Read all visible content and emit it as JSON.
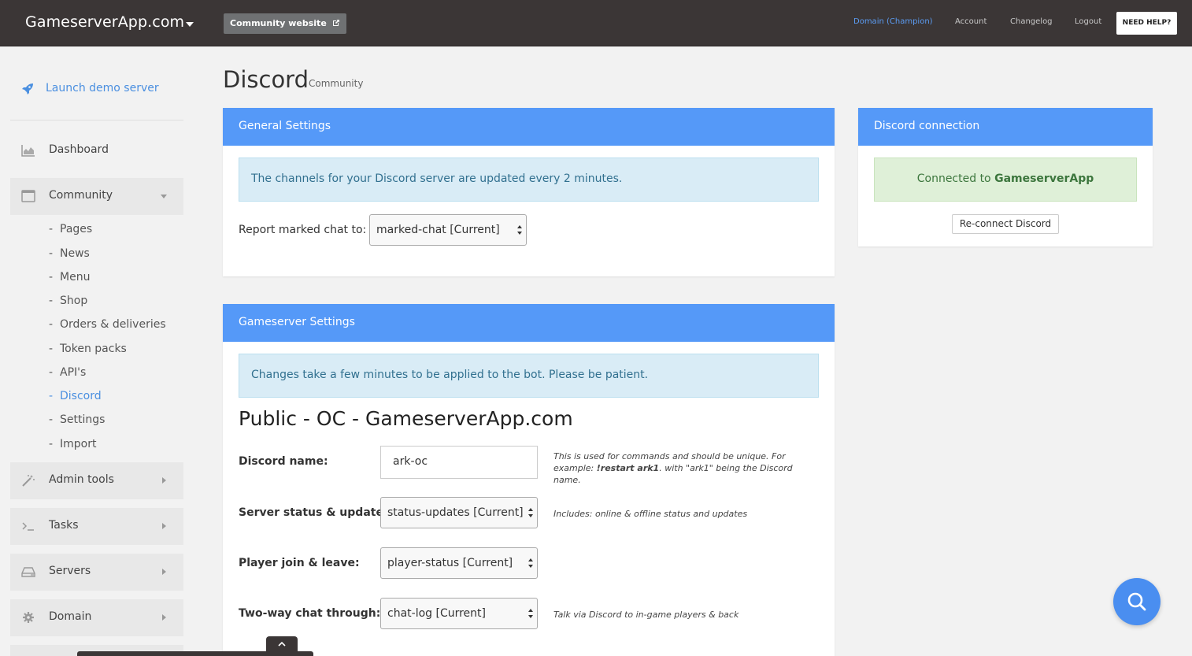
{
  "topbar": {
    "brand": "GameserverApp.com",
    "community_button": "Community website",
    "nav": {
      "domain": "Domain (Champion)",
      "account": "Account",
      "changelog": "Changelog",
      "logout": "Logout"
    },
    "help": "NEED HELP?"
  },
  "sidebar": {
    "launch": "Launch demo server",
    "items": {
      "dashboard": "Dashboard",
      "community": "Community",
      "admin_tools": "Admin tools",
      "tasks": "Tasks",
      "servers": "Servers",
      "domain": "Domain"
    },
    "sub_items": [
      "Pages",
      "News",
      "Menu",
      "Shop",
      "Orders & deliveries",
      "Token packs",
      "API's",
      "Discord",
      "Settings",
      "Import"
    ],
    "active_sub": "Discord"
  },
  "page": {
    "title": "Discord",
    "subtitle": "Community"
  },
  "general_settings": {
    "heading": "General Settings",
    "info": "The channels for your Discord server are updated every 2 minutes.",
    "report_label": "Report marked chat to:",
    "report_value": "marked-chat [Current]"
  },
  "discord_connection": {
    "heading": "Discord connection",
    "status_prefix": "Connected to ",
    "status_name": "GameserverApp",
    "reconnect": "Re-connect Discord"
  },
  "gameserver_settings": {
    "heading": "Gameserver Settings",
    "info": "Changes take a few minutes to be applied to the bot. Please be patient.",
    "server_title": "Public - OC - GameserverApp.com",
    "fields": {
      "discord_name_label": "Discord name:",
      "discord_name_value": "ark-oc",
      "discord_name_hint_1": "This is used for commands and should be unique. For",
      "discord_name_hint_2a": "example: ",
      "discord_name_hint_2b": "!restart ark1",
      "discord_name_hint_2c": ". with \"ark1\" being the Discord name.",
      "status_label": "Server status & updates:",
      "status_value": "status-updates [Current]",
      "status_hint": "Includes: online & offline status and updates",
      "player_label": "Player join & leave:",
      "player_value": "player-status [Current]",
      "chat_label": "Two-way chat through:",
      "chat_value": "chat-log [Current]",
      "chat_hint": "Talk via Discord to in-game players & back"
    }
  },
  "colors": {
    "topbar": "#3b3636",
    "panel_header": "#5599f8",
    "link": "#4a8fe0",
    "info_bg": "#d9ecf6",
    "success_bg": "#dff0d8"
  },
  "icons": {
    "launch": "rocket-icon",
    "dashboard": "area-chart-icon",
    "community": "window-icon",
    "admin_tools": "magic-wand-icon",
    "tasks": "terminal-icon",
    "servers": "hard-drive-icon",
    "domain": "gear-icon",
    "search": "search-icon"
  }
}
